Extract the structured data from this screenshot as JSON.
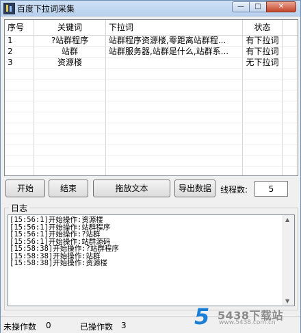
{
  "window": {
    "title": "百度下拉词采集",
    "min_glyph": "—",
    "max_glyph": "□",
    "close_glyph": "✕"
  },
  "grid": {
    "columns": [
      "序号",
      "关键词",
      "下拉词",
      "状态"
    ],
    "rows": [
      {
        "index": "1",
        "keyword": "?站群程序",
        "suggestions": "站群程序资源楼,零距离站群程...",
        "status": "有下拉词"
      },
      {
        "index": "2",
        "keyword": "站群",
        "suggestions": "站群服务器,站群是什么,站群系...",
        "status": "有下拉词"
      },
      {
        "index": "3",
        "keyword": "资源楼",
        "suggestions": "",
        "status": "无下拉词"
      }
    ]
  },
  "toolbar": {
    "start_label": "开始",
    "end_label": "结束",
    "drag_label": "拖放文本",
    "export_label": "导出数据",
    "thread_label": "线程数:",
    "thread_value": "5"
  },
  "log": {
    "legend": "日志",
    "lines": [
      "[15:56:1]开始操作:资源楼",
      "[15:56:1]开始操作:站群程序",
      "[15:56:1]开始操作:?站群",
      "[15:56:1]开始操作:站群源码",
      "[15:58:38]开始操作:?站群程序",
      "[15:58:38]开始操作:站群",
      "[15:58:38]开始操作:资源楼"
    ]
  },
  "status": {
    "pending_label": "未操作数",
    "pending_value": "0",
    "done_label": "已操作数",
    "done_value": "3"
  },
  "watermark": {
    "logo_digit": "5",
    "title": "5438下载站",
    "url": "www.5438.com.cn"
  },
  "icons": {
    "app": "app-icon",
    "minimize": "minimize-icon",
    "maximize": "maximize-icon",
    "close": "close-icon"
  }
}
